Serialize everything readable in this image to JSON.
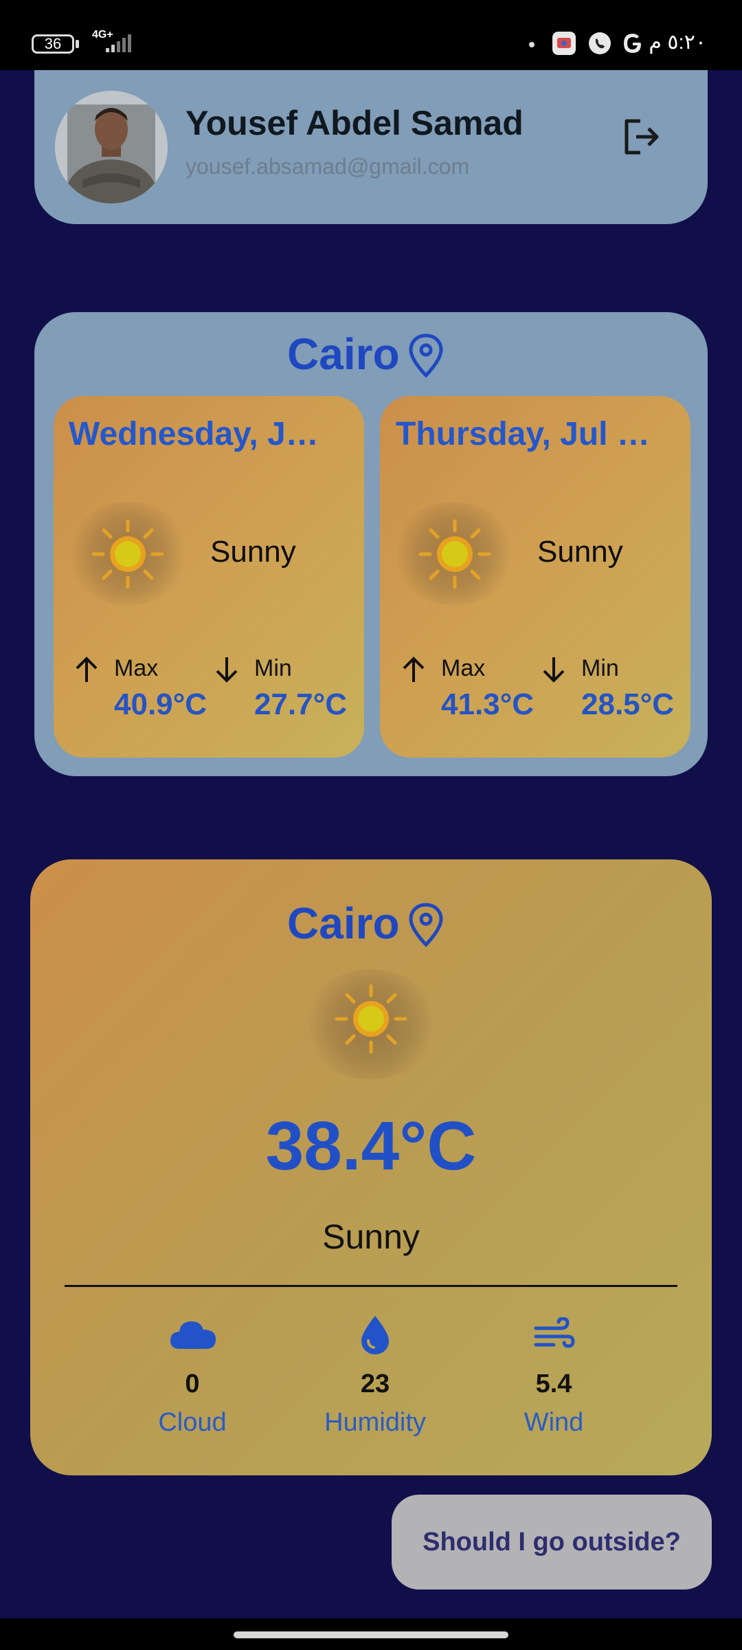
{
  "status_bar": {
    "battery_level": "36",
    "network": "4G+",
    "time": "٥:٢٠ م",
    "icons": [
      "dot-icon",
      "app-icon",
      "viber-icon",
      "google-icon"
    ]
  },
  "profile": {
    "name": "Yousef Abdel Samad",
    "email": "yousef.absamad@gmail.com",
    "logout_icon": "logout-icon"
  },
  "forecast": {
    "city": "Cairo",
    "days": [
      {
        "title": "Wednesday, J…",
        "condition": "Sunny",
        "max_label": "Max",
        "max": "40.9°C",
        "min_label": "Min",
        "min": "27.7°C"
      },
      {
        "title": "Thursday, Jul …",
        "condition": "Sunny",
        "max_label": "Max",
        "max": "41.3°C",
        "min_label": "Min",
        "min": "28.5°C"
      }
    ]
  },
  "current": {
    "city": "Cairo",
    "temperature": "38.4°C",
    "condition": "Sunny",
    "stats": [
      {
        "icon": "cloud-icon",
        "value": "0",
        "label": "Cloud"
      },
      {
        "icon": "humidity-drop-icon",
        "value": "23",
        "label": "Humidity"
      },
      {
        "icon": "wind-icon",
        "value": "5.4",
        "label": "Wind"
      }
    ]
  },
  "button": {
    "label": "Should I go outside?"
  },
  "colors": {
    "background": "#100f4a",
    "card_blue": "#819db7",
    "accent": "#2150c6",
    "warm_gradient_start": "#cc8f4a",
    "warm_gradient_end": "#c7b15a"
  }
}
